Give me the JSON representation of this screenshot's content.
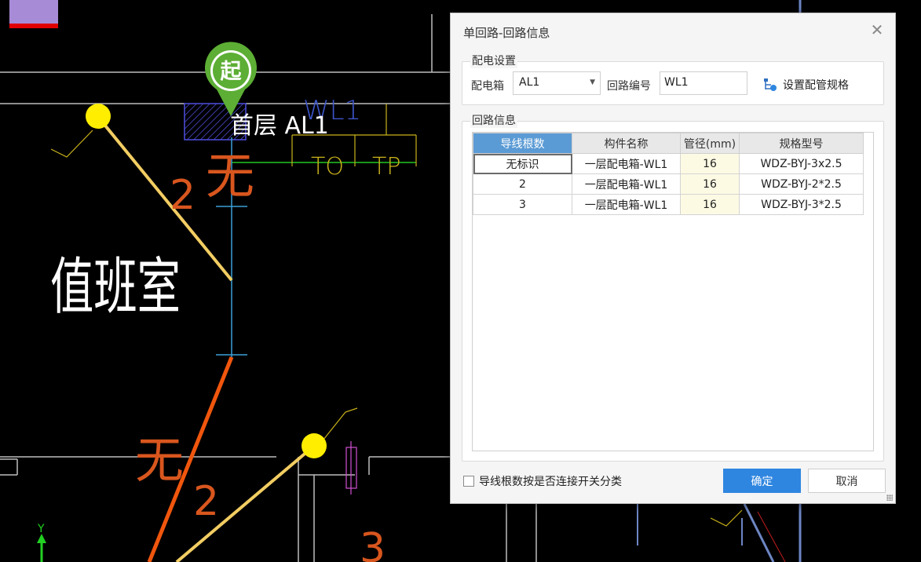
{
  "cad": {
    "start_marker": "起",
    "panel_label": "首层 AL1",
    "wire_label": "WL1",
    "tag_to": "TO",
    "tag_tp": "TP",
    "room_name": "值班室",
    "count_2": "2",
    "count_none": "无",
    "count_2b": "2",
    "count_none_b": "无",
    "count_3": "3",
    "axis_y": "Y"
  },
  "dialog": {
    "title": "单回路-回路信息",
    "close_icon": "close-icon",
    "distribution": {
      "legend": "配电设置",
      "box_label": "配电箱",
      "box_value": "AL1",
      "circuit_label": "回路编号",
      "circuit_value": "WL1",
      "pipe_spec_button": "设置配管规格"
    },
    "circuit_info": {
      "legend": "回路信息",
      "headers": [
        "导线根数",
        "构件名称",
        "管径(mm)",
        "规格型号"
      ],
      "rows": [
        [
          "无标识",
          "一层配电箱-WL1",
          "16",
          "WDZ-BYJ-3x2.5"
        ],
        [
          "2",
          "一层配电箱-WL1",
          "16",
          "WDZ-BYJ-2*2.5"
        ],
        [
          "3",
          "一层配电箱-WL1",
          "16",
          "WDZ-BYJ-3*2.5"
        ]
      ]
    },
    "checkbox_label": "导线根数按是否连接开关分类",
    "ok_label": "确定",
    "cancel_label": "取消"
  },
  "colors": {
    "cad_background": "#000000",
    "accent_button": "#2f86e0",
    "header_selected": "#5b9bd5",
    "pipe_column": "#fdfae4"
  }
}
